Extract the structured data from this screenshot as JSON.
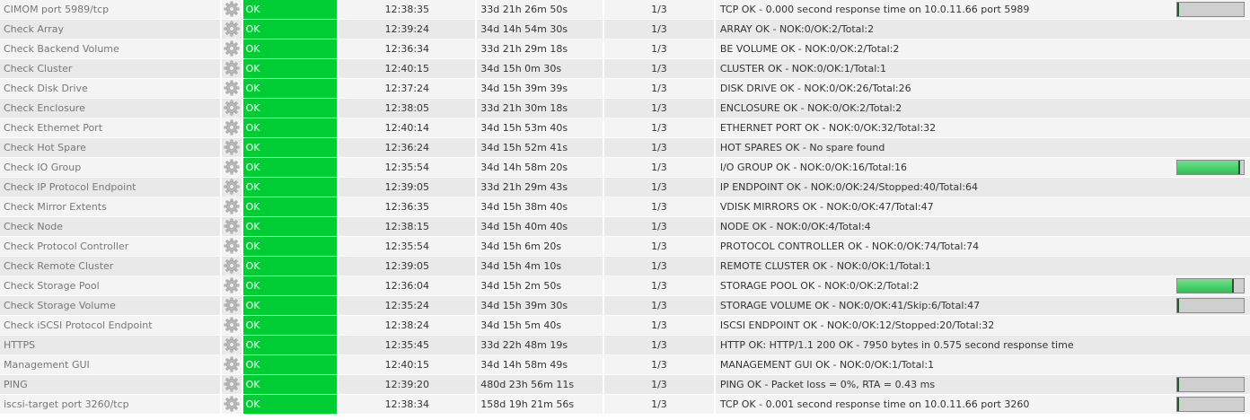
{
  "status_color": "#00cc33",
  "gear_icon": "gear-icon",
  "rows": [
    {
      "service": "CIMOM port 5989/tcp",
      "status": "OK",
      "last_check": "12:38:35",
      "duration": "33d 21h 26m 50s",
      "attempt": "1/3",
      "info": "TCP OK - 0.000 second response time on 10.0.11.66 port 5989",
      "perf": 0.0
    },
    {
      "service": "Check Array",
      "status": "OK",
      "last_check": "12:39:24",
      "duration": "34d 14h 54m 30s",
      "attempt": "1/3",
      "info": "ARRAY OK - NOK:0/OK:2/Total:2"
    },
    {
      "service": "Check Backend Volume",
      "status": "OK",
      "last_check": "12:36:34",
      "duration": "33d 21h 29m 18s",
      "attempt": "1/3",
      "info": "BE VOLUME OK - NOK:0/OK:2/Total:2"
    },
    {
      "service": "Check Cluster",
      "status": "OK",
      "last_check": "12:40:15",
      "duration": "34d 15h 0m 30s",
      "attempt": "1/3",
      "info": "CLUSTER OK - NOK:0/OK:1/Total:1"
    },
    {
      "service": "Check Disk Drive",
      "status": "OK",
      "last_check": "12:37:24",
      "duration": "34d 15h 39m 39s",
      "attempt": "1/3",
      "info": "DISK DRIVE OK - NOK:0/OK:26/Total:26"
    },
    {
      "service": "Check Enclosure",
      "status": "OK",
      "last_check": "12:38:05",
      "duration": "33d 21h 30m 18s",
      "attempt": "1/3",
      "info": "ENCLOSURE OK - NOK:0/OK:2/Total:2"
    },
    {
      "service": "Check Ethernet Port",
      "status": "OK",
      "last_check": "12:40:14",
      "duration": "34d 15h 53m 40s",
      "attempt": "1/3",
      "info": "ETHERNET PORT OK - NOK:0/OK:32/Total:32"
    },
    {
      "service": "Check Hot Spare",
      "status": "OK",
      "last_check": "12:36:24",
      "duration": "34d 15h 52m 41s",
      "attempt": "1/3",
      "info": "HOT SPARES OK - No spare found"
    },
    {
      "service": "Check IO Group",
      "status": "OK",
      "last_check": "12:35:54",
      "duration": "34d 14h 58m 20s",
      "attempt": "1/3",
      "info": "I/O GROUP OK - NOK:0/OK:16/Total:16",
      "perf": 0.92
    },
    {
      "service": "Check IP Protocol Endpoint",
      "status": "OK",
      "last_check": "12:39:05",
      "duration": "33d 21h 29m 43s",
      "attempt": "1/3",
      "info": "IP ENDPOINT OK - NOK:0/OK:24/Stopped:40/Total:64"
    },
    {
      "service": "Check Mirror Extents",
      "status": "OK",
      "last_check": "12:36:35",
      "duration": "34d 15h 38m 40s",
      "attempt": "1/3",
      "info": "VDISK MIRRORS OK - NOK:0/OK:47/Total:47"
    },
    {
      "service": "Check Node",
      "status": "OK",
      "last_check": "12:38:15",
      "duration": "34d 15h 40m 40s",
      "attempt": "1/3",
      "info": "NODE OK - NOK:0/OK:4/Total:4"
    },
    {
      "service": "Check Protocol Controller",
      "status": "OK",
      "last_check": "12:35:54",
      "duration": "34d 15h 6m 20s",
      "attempt": "1/3",
      "info": "PROTOCOL CONTROLLER OK - NOK:0/OK:74/Total:74"
    },
    {
      "service": "Check Remote Cluster",
      "status": "OK",
      "last_check": "12:39:05",
      "duration": "34d 15h 4m 10s",
      "attempt": "1/3",
      "info": "REMOTE CLUSTER OK - NOK:0/OK:1/Total:1"
    },
    {
      "service": "Check Storage Pool",
      "status": "OK",
      "last_check": "12:36:04",
      "duration": "34d 15h 2m 50s",
      "attempt": "1/3",
      "info": "STORAGE POOL OK - NOK:0/OK:2/Total:2",
      "perf": 0.82
    },
    {
      "service": "Check Storage Volume",
      "status": "OK",
      "last_check": "12:35:24",
      "duration": "34d 15h 39m 30s",
      "attempt": "1/3",
      "info": "STORAGE VOLUME OK - NOK:0/OK:41/Skip:6/Total:47",
      "perf": 0.0
    },
    {
      "service": "Check iSCSI Protocol Endpoint",
      "status": "OK",
      "last_check": "12:38:24",
      "duration": "34d 15h 5m 40s",
      "attempt": "1/3",
      "info": "ISCSI ENDPOINT OK - NOK:0/OK:12/Stopped:20/Total:32"
    },
    {
      "service": "HTTPS",
      "status": "OK",
      "last_check": "12:35:45",
      "duration": "33d 22h 48m 19s",
      "attempt": "1/3",
      "info": "HTTP OK: HTTP/1.1 200 OK - 7950 bytes in 0.575 second response time"
    },
    {
      "service": "Management GUI",
      "status": "OK",
      "last_check": "12:40:15",
      "duration": "34d 14h 58m 49s",
      "attempt": "1/3",
      "info": "MANAGEMENT GUI OK - NOK:0/OK:1/Total:1"
    },
    {
      "service": "PING",
      "status": "OK",
      "last_check": "12:39:20",
      "duration": "480d 23h 56m 11s",
      "attempt": "1/3",
      "info": "PING OK - Packet loss = 0%, RTA = 0.43 ms",
      "perf": 0.0
    },
    {
      "service": "iscsi-target port 3260/tcp",
      "status": "OK",
      "last_check": "12:38:34",
      "duration": "158d 19h 21m 56s",
      "attempt": "1/3",
      "info": "TCP OK - 0.001 second response time on 10.0.11.66 port 3260",
      "perf": 0.0
    }
  ]
}
